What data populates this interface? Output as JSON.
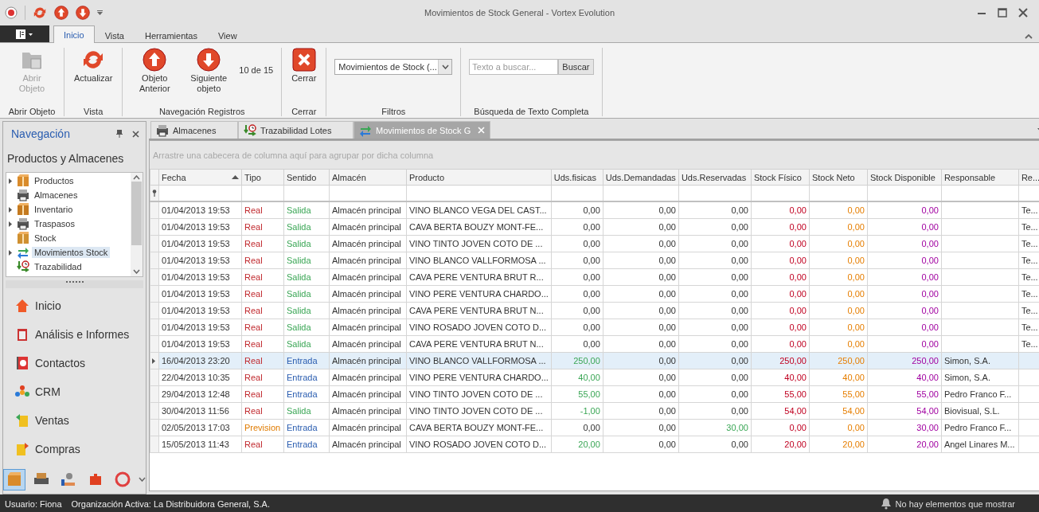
{
  "window": {
    "title": "Movimientos de Stock General - Vortex Evolution"
  },
  "ribbon": {
    "tabs": [
      {
        "label": "Inicio",
        "selected": true
      },
      {
        "label": "Vista",
        "selected": false
      },
      {
        "label": "Herramientas",
        "selected": false
      },
      {
        "label": "View",
        "selected": false
      }
    ],
    "groups": [
      {
        "label": "Abrir Objeto",
        "buttons": [
          {
            "label": "Abrir Objeto",
            "disabled": true
          }
        ]
      },
      {
        "label": "Vista",
        "buttons": [
          {
            "label": "Actualizar",
            "disabled": false
          }
        ]
      },
      {
        "label": "Navegación Registros",
        "buttons": [
          {
            "label": "Objeto Anterior",
            "disabled": false
          },
          {
            "label": "Siguiente objeto",
            "disabled": false
          }
        ],
        "counter": "10 de 15"
      },
      {
        "label": "Cerrar",
        "buttons": [
          {
            "label": "Cerrar",
            "disabled": false
          }
        ]
      },
      {
        "label": "Filtros",
        "dropdown": "Movimientos de Stock (..."
      },
      {
        "label": "Búsqueda de Texto Completa",
        "search": {
          "placeholder": "Texto a buscar...",
          "button": "Buscar"
        }
      }
    ]
  },
  "navigation": {
    "title": "Navegación",
    "section": "Productos y Almacenes",
    "tree": [
      {
        "label": "Productos",
        "has_children": true,
        "selected": false
      },
      {
        "label": "Almacenes",
        "has_children": false,
        "selected": false
      },
      {
        "label": "Inventario",
        "has_children": true,
        "selected": false
      },
      {
        "label": "Traspasos",
        "has_children": true,
        "selected": false
      },
      {
        "label": "Stock",
        "has_children": false,
        "selected": false
      },
      {
        "label": "Movimientos Stock",
        "has_children": true,
        "selected": true
      },
      {
        "label": "Trazabilidad",
        "has_children": false,
        "selected": false
      }
    ],
    "groups": [
      {
        "label": "Inicio"
      },
      {
        "label": "Análisis e Informes"
      },
      {
        "label": "Contactos"
      },
      {
        "label": "CRM"
      },
      {
        "label": "Ventas"
      },
      {
        "label": "Compras"
      }
    ],
    "shortcuts": [
      {
        "selected": true
      },
      {
        "selected": false
      },
      {
        "selected": false
      },
      {
        "selected": false
      },
      {
        "selected": false
      }
    ]
  },
  "document_tabs": [
    {
      "label": "Almacenes",
      "selected": false
    },
    {
      "label": "Trazabilidad Lotes",
      "selected": false
    },
    {
      "label": "Movimientos de Stock G",
      "selected": true
    }
  ],
  "grid": {
    "group_hint": "Arrastre una cabecera de columna aquí para agrupar por dicha columna",
    "columns": [
      "Fecha",
      "Tipo",
      "Sentido",
      "Almacén",
      "Producto",
      "Uds.fisicas",
      "Uds.Demandadas",
      "Uds.Reservadas",
      "Stock Físico",
      "Stock Neto",
      "Stock Disponible",
      "Responsable",
      "Re..."
    ],
    "rows": [
      {
        "selected": false,
        "fecha": "01/04/2013 19:53",
        "tipo": {
          "text": "Real",
          "color": "#c0282d"
        },
        "sentido": {
          "text": "Salida",
          "color": "#3aa655"
        },
        "almacen": "Almacén principal",
        "producto": "VINO BLANCO VEGA DEL CAST...",
        "uds_fisicas": "0,00",
        "uds_demandadas": "0,00",
        "uds_reservadas": "0,00",
        "stock_fisico": "0,00",
        "stock_neto": "0,00",
        "stock_disponible": "0,00",
        "column_13": "Te..."
      },
      {
        "selected": false,
        "fecha": "01/04/2013 19:53",
        "tipo": {
          "text": "Real",
          "color": "#c0282d"
        },
        "sentido": {
          "text": "Salida",
          "color": "#3aa655"
        },
        "almacen": "Almacén principal",
        "producto": "CAVA BERTA BOUZY MONT-FE...",
        "uds_fisicas": "0,00",
        "uds_demandadas": "0,00",
        "uds_reservadas": "0,00",
        "stock_fisico": "0,00",
        "stock_neto": "0,00",
        "stock_disponible": "0,00",
        "column_13": "Te..."
      },
      {
        "selected": false,
        "fecha": "01/04/2013 19:53",
        "tipo": {
          "text": "Real",
          "color": "#c0282d"
        },
        "sentido": {
          "text": "Salida",
          "color": "#3aa655"
        },
        "almacen": "Almacén principal",
        "producto": "VINO TINTO JOVEN COTO DE ...",
        "uds_fisicas": "0,00",
        "uds_demandadas": "0,00",
        "uds_reservadas": "0,00",
        "stock_fisico": "0,00",
        "stock_neto": "0,00",
        "stock_disponible": "0,00",
        "column_13": "Te..."
      },
      {
        "selected": false,
        "fecha": "01/04/2013 19:53",
        "tipo": {
          "text": "Real",
          "color": "#c0282d"
        },
        "sentido": {
          "text": "Salida",
          "color": "#3aa655"
        },
        "almacen": "Almacén principal",
        "producto": "VINO BLANCO VALLFORMOSA ...",
        "uds_fisicas": "0,00",
        "uds_demandadas": "0,00",
        "uds_reservadas": "0,00",
        "stock_fisico": "0,00",
        "stock_neto": "0,00",
        "stock_disponible": "0,00",
        "column_13": "Te..."
      },
      {
        "selected": false,
        "fecha": "01/04/2013 19:53",
        "tipo": {
          "text": "Real",
          "color": "#c0282d"
        },
        "sentido": {
          "text": "Salida",
          "color": "#3aa655"
        },
        "almacen": "Almacén principal",
        "producto": "CAVA PERE VENTURA BRUT R...",
        "uds_fisicas": "0,00",
        "uds_demandadas": "0,00",
        "uds_reservadas": "0,00",
        "stock_fisico": "0,00",
        "stock_neto": "0,00",
        "stock_disponible": "0,00",
        "column_13": "Te..."
      },
      {
        "selected": false,
        "fecha": "01/04/2013 19:53",
        "tipo": {
          "text": "Real",
          "color": "#c0282d"
        },
        "sentido": {
          "text": "Salida",
          "color": "#3aa655"
        },
        "almacen": "Almacén principal",
        "producto": "VINO PERE VENTURA CHARDO...",
        "uds_fisicas": "0,00",
        "uds_demandadas": "0,00",
        "uds_reservadas": "0,00",
        "stock_fisico": "0,00",
        "stock_neto": "0,00",
        "stock_disponible": "0,00",
        "column_13": "Te..."
      },
      {
        "selected": false,
        "fecha": "01/04/2013 19:53",
        "tipo": {
          "text": "Real",
          "color": "#c0282d"
        },
        "sentido": {
          "text": "Salida",
          "color": "#3aa655"
        },
        "almacen": "Almacén principal",
        "producto": "CAVA PERE VENTURA BRUT N...",
        "uds_fisicas": "0,00",
        "uds_demandadas": "0,00",
        "uds_reservadas": "0,00",
        "stock_fisico": "0,00",
        "stock_neto": "0,00",
        "stock_disponible": "0,00",
        "column_13": "Te..."
      },
      {
        "selected": false,
        "fecha": "01/04/2013 19:53",
        "tipo": {
          "text": "Real",
          "color": "#c0282d"
        },
        "sentido": {
          "text": "Salida",
          "color": "#3aa655"
        },
        "almacen": "Almacén principal",
        "producto": "VINO ROSADO JOVEN COTO D...",
        "uds_fisicas": "0,00",
        "uds_demandadas": "0,00",
        "uds_reservadas": "0,00",
        "stock_fisico": "0,00",
        "stock_neto": "0,00",
        "stock_disponible": "0,00",
        "column_13": "Te..."
      },
      {
        "selected": false,
        "fecha": "01/04/2013 19:53",
        "tipo": {
          "text": "Real",
          "color": "#c0282d"
        },
        "sentido": {
          "text": "Salida",
          "color": "#3aa655"
        },
        "almacen": "Almacén principal",
        "producto": "CAVA PERE VENTURA BRUT N...",
        "uds_fisicas": "0,00",
        "uds_demandadas": "0,00",
        "uds_reservadas": "0,00",
        "stock_fisico": "0,00",
        "stock_neto": "0,00",
        "stock_disponible": "0,00",
        "column_13": "Te..."
      },
      {
        "selected": true,
        "fecha": "16/04/2013 23:20",
        "tipo": {
          "text": "Real",
          "color": "#c0282d"
        },
        "sentido": {
          "text": "Entrada",
          "color": "#2a5db0"
        },
        "almacen": "Almacén principal",
        "producto": "VINO BLANCO VALLFORMOSA ...",
        "uds_fisicas": {
          "text": "250,00",
          "color": "#3aa655"
        },
        "uds_demandadas": "0,00",
        "uds_reservadas": "0,00",
        "stock_fisico": "250,00",
        "stock_neto": "250,00",
        "stock_disponible": "250,00",
        "responsable": "Simon, S.A."
      },
      {
        "selected": false,
        "fecha": "22/04/2013 10:35",
        "tipo": {
          "text": "Real",
          "color": "#c0282d"
        },
        "sentido": {
          "text": "Entrada",
          "color": "#2a5db0"
        },
        "almacen": "Almacén principal",
        "producto": "VINO PERE VENTURA CHARDO...",
        "uds_fisicas": {
          "text": "40,00",
          "color": "#3aa655"
        },
        "uds_demandadas": "0,00",
        "uds_reservadas": "0,00",
        "stock_fisico": "40,00",
        "stock_neto": "40,00",
        "stock_disponible": "40,00",
        "responsable": "Simon, S.A."
      },
      {
        "selected": false,
        "fecha": "29/04/2013 12:48",
        "tipo": {
          "text": "Real",
          "color": "#c0282d"
        },
        "sentido": {
          "text": "Entrada",
          "color": "#2a5db0"
        },
        "almacen": "Almacén principal",
        "producto": "VINO TINTO JOVEN COTO DE ...",
        "uds_fisicas": {
          "text": "55,00",
          "color": "#3aa655"
        },
        "uds_demandadas": "0,00",
        "uds_reservadas": "0,00",
        "stock_fisico": "55,00",
        "stock_neto": "55,00",
        "stock_disponible": "55,00",
        "responsable": "Pedro Franco F..."
      },
      {
        "selected": false,
        "fecha": "30/04/2013 11:56",
        "tipo": {
          "text": "Real",
          "color": "#c0282d"
        },
        "sentido": {
          "text": "Salida",
          "color": "#3aa655"
        },
        "almacen": "Almacén principal",
        "producto": "VINO TINTO JOVEN COTO DE ...",
        "uds_fisicas": {
          "text": "-1,00",
          "color": "#3aa655"
        },
        "uds_demandadas": "0,00",
        "uds_reservadas": "0,00",
        "stock_fisico": "54,00",
        "stock_neto": "54,00",
        "stock_disponible": "54,00",
        "responsable": "Biovisual, S.L."
      },
      {
        "selected": false,
        "fecha": "02/05/2013 17:03",
        "tipo": {
          "text": "Prevision",
          "color": "#e07b00"
        },
        "sentido": {
          "text": "Entrada",
          "color": "#2a5db0"
        },
        "almacen": "Almacén principal",
        "producto": "CAVA BERTA BOUZY MONT-FE...",
        "uds_fisicas": "0,00",
        "uds_demandadas": "0,00",
        "uds_reservadas": {
          "text": "30,00",
          "color": "#3aa655"
        },
        "stock_fisico": "0,00",
        "stock_neto": "0,00",
        "stock_disponible": "30,00",
        "responsable": "Pedro Franco F..."
      },
      {
        "selected": false,
        "fecha": "15/05/2013 11:43",
        "tipo": {
          "text": "Real",
          "color": "#c0282d"
        },
        "sentido": {
          "text": "Entrada",
          "color": "#2a5db0"
        },
        "almacen": "Almacén principal",
        "producto": "VINO ROSADO JOVEN COTO D...",
        "uds_fisicas": {
          "text": "20,00",
          "color": "#3aa655"
        },
        "uds_demandadas": "0,00",
        "uds_reservadas": "0,00",
        "stock_fisico": "20,00",
        "stock_neto": "20,00",
        "stock_disponible": "20,00",
        "responsable": "Angel Linares M..."
      }
    ]
  },
  "status_bar": {
    "user": "Usuario: Fiona",
    "organization": "Organización Activa: La Distribuidora General, S.A.",
    "notifications": "No hay elementos que mostrar"
  }
}
